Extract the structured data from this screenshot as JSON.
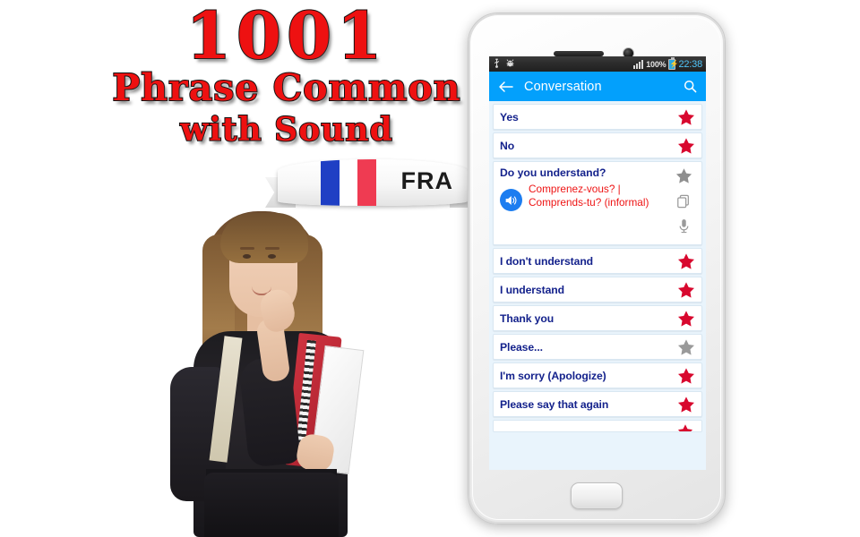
{
  "promo": {
    "line1": "1001",
    "line2": "Phrase Common",
    "line3": "with Sound",
    "title_color": "#ee1111",
    "ribbon_code": "FRA",
    "flag_colors": [
      "#1f3fc4",
      "#ffffff",
      "#ef3b52"
    ]
  },
  "phone": {
    "statusbar": {
      "usb_icon": "usb-icon",
      "debug_icon": "android-debug-icon",
      "signal_icon": "signal-bars-icon",
      "battery_percent": "100%",
      "battery_icon": "battery-charging-icon",
      "time": "22:38",
      "background": "#2c2c2c"
    },
    "toolbar": {
      "back_icon": "back-arrow-icon",
      "title": "Conversation",
      "search_icon": "search-icon",
      "background": "#03a0fc"
    },
    "colors": {
      "phrase_text": "#14228c",
      "translation_text": "#ee1515",
      "star_favorite": "#d8082e",
      "star_inactive": "#9a9a9a",
      "list_background": "#e9f4fc",
      "card_background": "#ffffff"
    },
    "list": [
      {
        "en": "Yes",
        "favorite": true,
        "expanded": false
      },
      {
        "en": "No",
        "favorite": true,
        "expanded": false
      },
      {
        "en": "Do you understand?",
        "favorite": false,
        "expanded": true,
        "translation": "Comprenez-vous? | Comprends-tu? (informal)",
        "speaker_icon": "speaker-sound-icon",
        "copy_icon": "copy-icon",
        "mic_icon": "microphone-icon"
      },
      {
        "en": "I don't understand",
        "favorite": true,
        "expanded": false
      },
      {
        "en": "I understand",
        "favorite": true,
        "expanded": false
      },
      {
        "en": "Thank you",
        "favorite": true,
        "expanded": false
      },
      {
        "en": "Please...",
        "favorite": false,
        "expanded": false
      },
      {
        "en": "I'm sorry (Apologize)",
        "favorite": true,
        "expanded": false
      },
      {
        "en": "Please say that again",
        "favorite": true,
        "expanded": false
      }
    ],
    "home_button": "home-button"
  }
}
